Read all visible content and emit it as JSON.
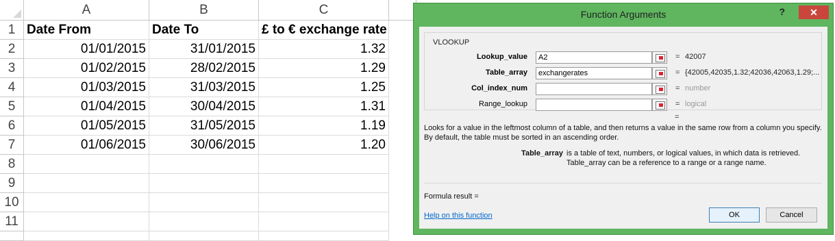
{
  "sheet": {
    "columns": [
      "A",
      "B",
      "C"
    ],
    "rows": [
      "1",
      "2",
      "3",
      "4",
      "5",
      "6",
      "7",
      "8",
      "9",
      "10",
      "11"
    ],
    "header": {
      "a": "Date From",
      "b": "Date To",
      "c": "£ to € exchange rate"
    },
    "data": [
      [
        "01/01/2015",
        "31/01/2015",
        "1.32"
      ],
      [
        "01/02/2015",
        "28/02/2015",
        "1.29"
      ],
      [
        "01/03/2015",
        "31/03/2015",
        "1.25"
      ],
      [
        "01/04/2015",
        "30/04/2015",
        "1.31"
      ],
      [
        "01/05/2015",
        "31/05/2015",
        "1.19"
      ],
      [
        "01/06/2015",
        "30/06/2015",
        "1.20"
      ]
    ]
  },
  "dialog": {
    "title": "Function Arguments",
    "help_glyph": "?",
    "close_glyph": "✕",
    "function_name": "VLOOKUP",
    "args": [
      {
        "label": "Lookup_value",
        "value": "A2",
        "result": "42007",
        "result_muted": false,
        "bold": true
      },
      {
        "label": "Table_array",
        "value": "exchangerates",
        "result": "{42005,42035,1.32;42036,42063,1.29;...",
        "result_muted": false,
        "bold": true
      },
      {
        "label": "Col_index_num",
        "value": "",
        "result": "number",
        "result_muted": true,
        "bold": true
      },
      {
        "label": "Range_lookup",
        "value": "",
        "result": "logical",
        "result_muted": true,
        "bold": false
      }
    ],
    "equals": "=",
    "description": "Looks for a value in the leftmost column of a table, and then returns a value in the same row from a column you specify. By default, the table must be sorted in an ascending order.",
    "arg_help_name": "Table_array",
    "arg_help_text_1": "is a table of text, numbers, or logical values, in which data is retrieved.",
    "arg_help_text_2": "Table_array can be a reference to a range or a range name.",
    "formula_result_label": "Formula result =",
    "help_link": "Help on this function",
    "ok_label": "OK",
    "cancel_label": "Cancel"
  },
  "colors": {
    "dialog_frame": "#5fb65f",
    "close_button": "#c9463d",
    "link": "#0066cc"
  }
}
